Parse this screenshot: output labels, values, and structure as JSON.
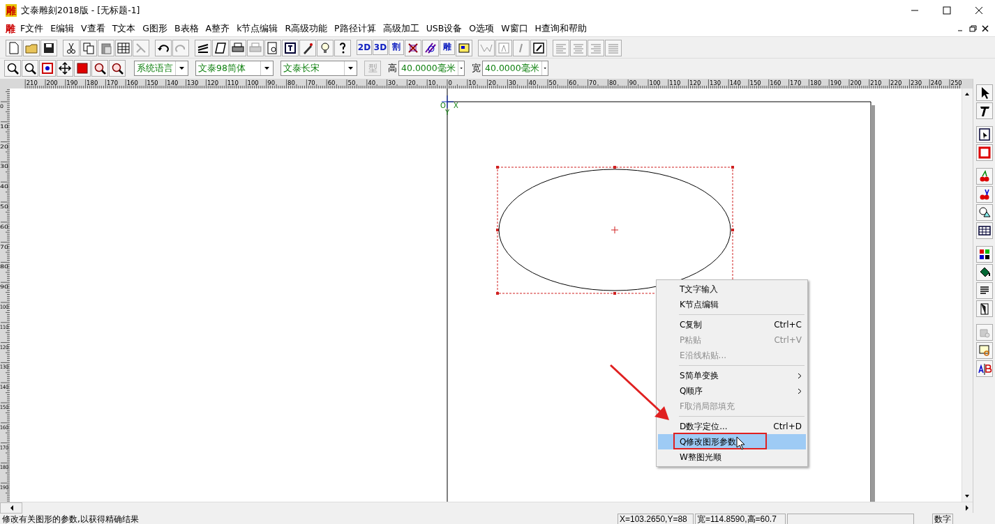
{
  "window": {
    "logo": "雕",
    "title": "文泰雕刻2018版 - [无标题-1]"
  },
  "menu_bar": {
    "logo": "雕",
    "items": [
      "F文件",
      "E编辑",
      "V查看",
      "T文本",
      "G图形",
      "B表格",
      "A整齐",
      "k节点编辑",
      "R高级功能",
      "P路径计算",
      "高级加工",
      "USB设备",
      "O选项",
      "W窗口",
      "H查询和帮助"
    ]
  },
  "toolbar": {
    "text_buttons": [
      "2D",
      "3D",
      "割",
      "雕"
    ]
  },
  "format_bar": {
    "language": "系统语言",
    "font_cn": "文泰98简体",
    "font_en": "文泰长宋",
    "style_button": {
      "label": "型",
      "disabled": true
    },
    "height_label": "高",
    "height": "40.0000毫米",
    "width_label": "宽",
    "width": "40.0000毫米"
  },
  "ruler": {
    "horizontal": [
      "210",
      "200",
      "190",
      "180",
      "170",
      "160",
      "150",
      "140",
      "130",
      "120",
      "110",
      "100",
      "90",
      "80",
      "70",
      "60",
      "50",
      "40",
      "30",
      "20",
      "10",
      "0",
      "10",
      "20",
      "30",
      "40",
      "50",
      "60",
      "70",
      "80",
      "90",
      "100",
      "110",
      "120",
      "130",
      "140",
      "150",
      "160",
      "170",
      "180",
      "190",
      "200",
      "210",
      "220",
      "230",
      "240",
      "250"
    ],
    "vertical": [
      "0",
      "10",
      "20",
      "30",
      "40",
      "50",
      "60",
      "70",
      "80",
      "90",
      "100",
      "110",
      "120",
      "130",
      "140",
      "150",
      "160",
      "170",
      "180",
      "190"
    ]
  },
  "canvas": {
    "origin_labels": [
      "O",
      "X",
      "Y"
    ]
  },
  "context_menu": {
    "items": [
      {
        "kind": "item",
        "label": "T文字输入",
        "disabled": false,
        "selected": false,
        "submenu": false
      },
      {
        "kind": "item",
        "label": "K节点编辑",
        "disabled": false,
        "selected": false,
        "submenu": false
      },
      {
        "kind": "separator"
      },
      {
        "kind": "item",
        "label": "C复制",
        "shortcut": "Ctrl+C",
        "disabled": false,
        "selected": false,
        "submenu": false
      },
      {
        "kind": "item",
        "label": "P粘贴",
        "shortcut": "Ctrl+V",
        "disabled": true,
        "selected": false,
        "submenu": false
      },
      {
        "kind": "item",
        "label": "E沿线粘贴...",
        "disabled": true,
        "selected": false,
        "submenu": false
      },
      {
        "kind": "separator"
      },
      {
        "kind": "item",
        "label": "S简单变换",
        "disabled": false,
        "selected": false,
        "submenu": true
      },
      {
        "kind": "item",
        "label": "Q顺序",
        "disabled": false,
        "selected": false,
        "submenu": true
      },
      {
        "kind": "item",
        "label": "F取消局部填充",
        "disabled": true,
        "selected": false,
        "submenu": false
      },
      {
        "kind": "separator"
      },
      {
        "kind": "item",
        "label": "D数字定位...",
        "shortcut": "Ctrl+D",
        "disabled": false,
        "selected": false,
        "submenu": false
      },
      {
        "kind": "item",
        "label": "Q修改图形参数",
        "disabled": false,
        "selected": true,
        "submenu": false
      },
      {
        "kind": "item",
        "label": "W整图光顺",
        "disabled": false,
        "selected": false,
        "submenu": false
      }
    ]
  },
  "status_bar": {
    "message": "修改有关图形的参数,以获得精确结果",
    "coords": "X=103.2650,Y=88",
    "size": "宽=114.8590,高=60.7",
    "mode": "数字"
  }
}
